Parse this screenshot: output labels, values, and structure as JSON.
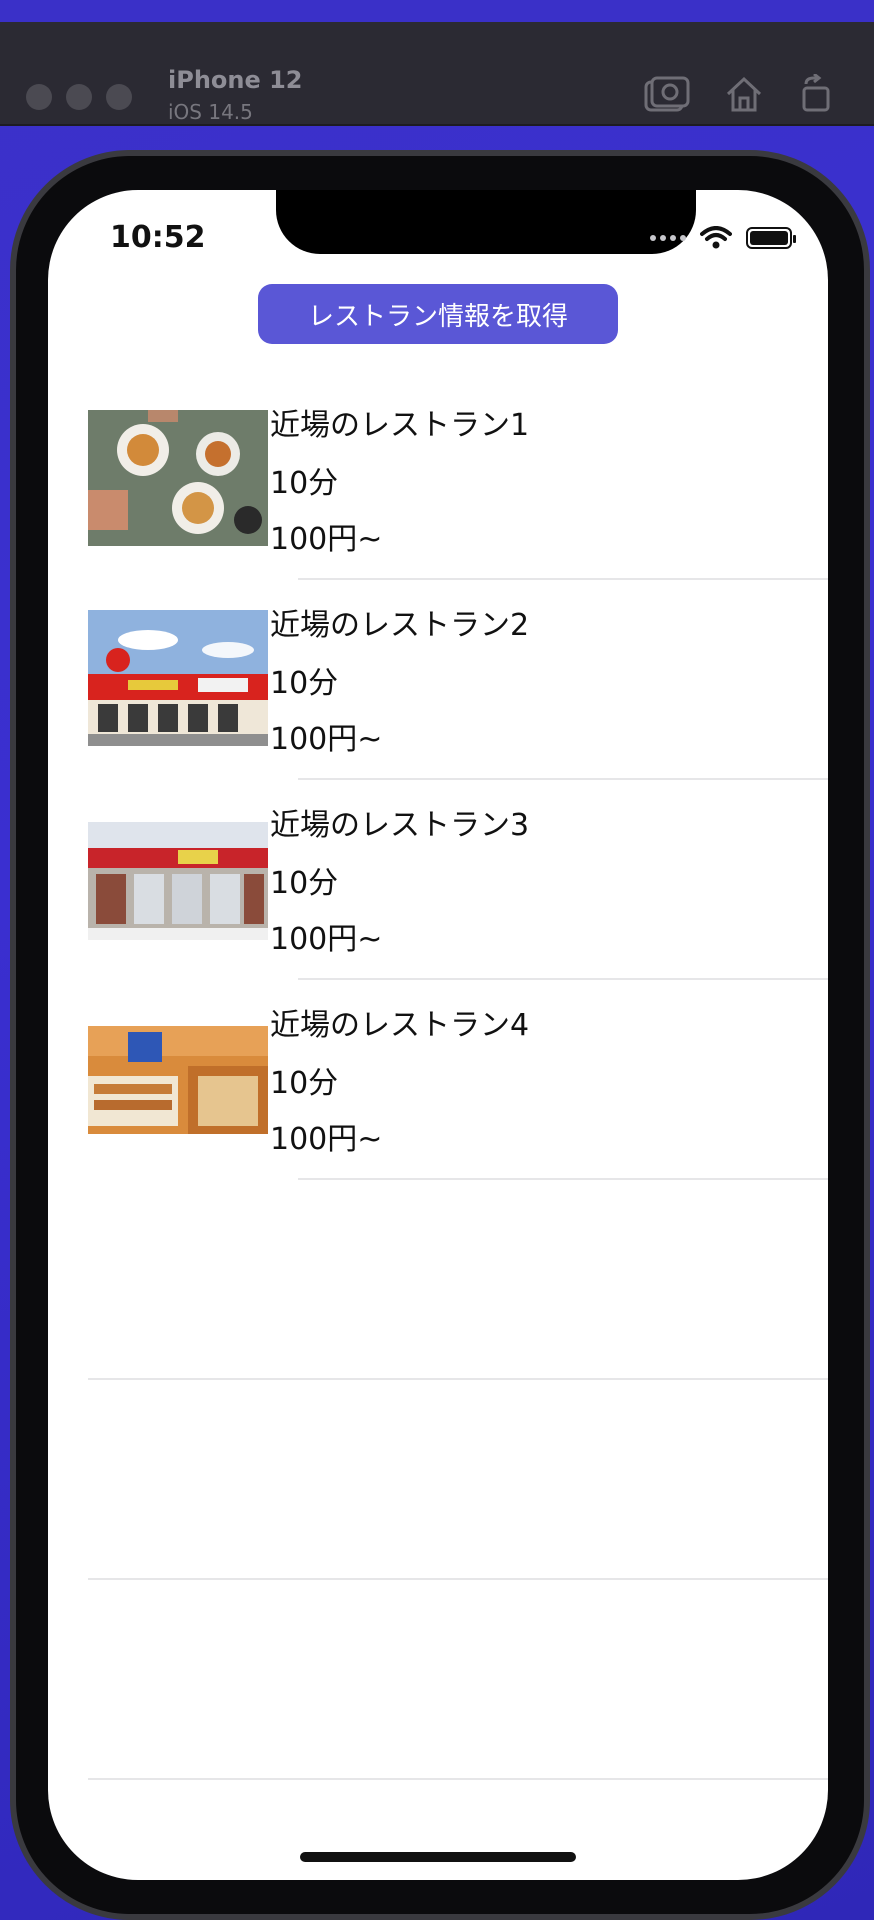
{
  "simulator": {
    "device_name": "iPhone 12",
    "os_version": "iOS 14.5",
    "toolbar_icons": [
      "screenshot-icon",
      "home-icon",
      "rotate-icon"
    ]
  },
  "status_bar": {
    "time": "10:52",
    "icons": [
      "signal-icon",
      "wifi-icon",
      "battery-icon"
    ]
  },
  "fetch_button": {
    "label": "レストラン情報を取得",
    "color": "#5a57d6"
  },
  "restaurants": [
    {
      "name": "近場のレストラン1",
      "time": "10分",
      "price": "100円~",
      "image": "food-table-photo"
    },
    {
      "name": "近場のレストラン2",
      "time": "10分",
      "price": "100円~",
      "image": "restaurant-storefront-red-photo"
    },
    {
      "name": "近場のレストラン3",
      "time": "10分",
      "price": "100円~",
      "image": "restaurant-storefront-shop-photo"
    },
    {
      "name": "近場のレストラン4",
      "time": "10分",
      "price": "100円~",
      "image": "restaurant-interior-photo"
    }
  ]
}
